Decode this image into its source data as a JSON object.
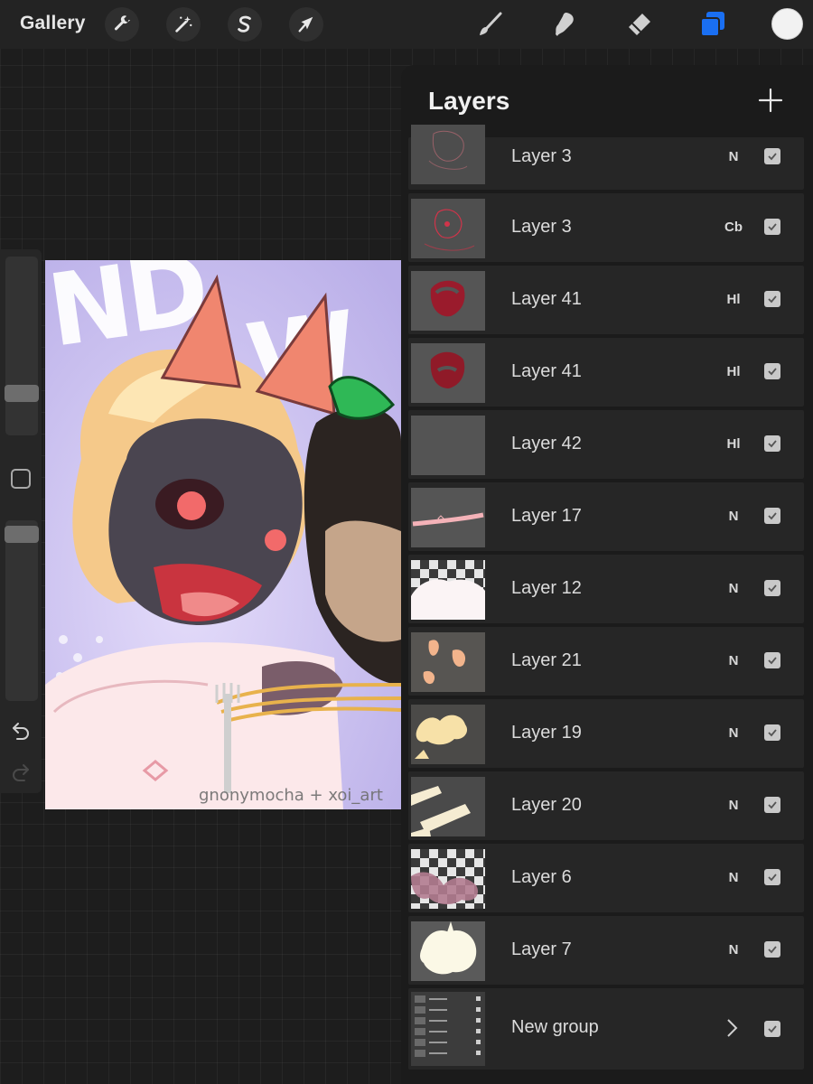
{
  "topbar": {
    "gallery_label": "Gallery",
    "left_tools": [
      "wrench-icon",
      "magic-wand-icon",
      "selection-s-icon",
      "transform-arrow-icon"
    ],
    "right_tools": [
      "brush-icon",
      "smudge-icon",
      "eraser-icon",
      "layers-icon"
    ],
    "active_tool": "layers-icon",
    "accent_color": "#1a6ff2",
    "current_color": "#f2f2f2"
  },
  "sidebar": {
    "brush_size_level": 0.72,
    "opacity_level": 0.02
  },
  "canvas": {
    "watermark": "gnonymocha + xoi_art"
  },
  "layers": {
    "title": "Layers",
    "items": [
      {
        "name": "Layer 3",
        "mode": "N",
        "visible": true
      },
      {
        "name": "Layer 3",
        "mode": "Cb",
        "visible": true
      },
      {
        "name": "Layer 41",
        "mode": "Hl",
        "visible": true
      },
      {
        "name": "Layer 41",
        "mode": "Hl",
        "visible": true
      },
      {
        "name": "Layer 42",
        "mode": "Hl",
        "visible": true
      },
      {
        "name": "Layer 17",
        "mode": "N",
        "visible": true
      },
      {
        "name": "Layer 12",
        "mode": "N",
        "visible": true
      },
      {
        "name": "Layer 21",
        "mode": "N",
        "visible": true
      },
      {
        "name": "Layer 19",
        "mode": "N",
        "visible": true
      },
      {
        "name": "Layer 20",
        "mode": "N",
        "visible": true
      },
      {
        "name": "Layer 6",
        "mode": "N",
        "visible": true
      },
      {
        "name": "Layer 7",
        "mode": "N",
        "visible": true
      }
    ],
    "group": {
      "name": "New group",
      "visible": true
    }
  }
}
